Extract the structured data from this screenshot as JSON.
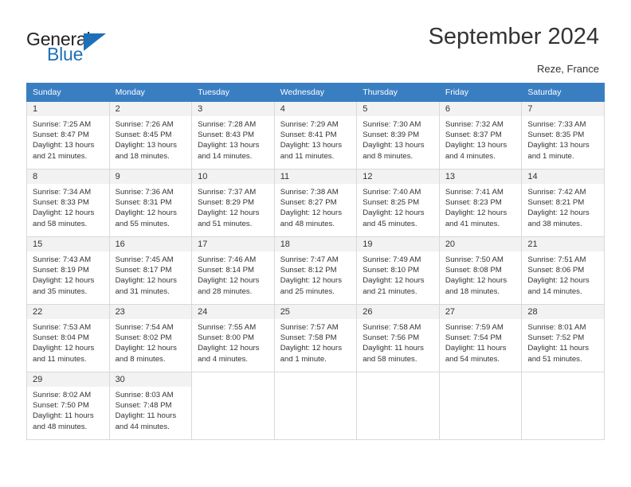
{
  "brand": {
    "name_top": "General",
    "name_bottom": "Blue",
    "accent_color": "#1d70b8"
  },
  "header": {
    "title": "September 2024",
    "location": "Reze, France"
  },
  "calendar": {
    "header_bg": "#3a7ec2",
    "weekdays": [
      "Sunday",
      "Monday",
      "Tuesday",
      "Wednesday",
      "Thursday",
      "Friday",
      "Saturday"
    ],
    "weeks": [
      [
        {
          "day": "1",
          "sunrise": "Sunrise: 7:25 AM",
          "sunset": "Sunset: 8:47 PM",
          "daylight1": "Daylight: 13 hours",
          "daylight2": "and 21 minutes."
        },
        {
          "day": "2",
          "sunrise": "Sunrise: 7:26 AM",
          "sunset": "Sunset: 8:45 PM",
          "daylight1": "Daylight: 13 hours",
          "daylight2": "and 18 minutes."
        },
        {
          "day": "3",
          "sunrise": "Sunrise: 7:28 AM",
          "sunset": "Sunset: 8:43 PM",
          "daylight1": "Daylight: 13 hours",
          "daylight2": "and 14 minutes."
        },
        {
          "day": "4",
          "sunrise": "Sunrise: 7:29 AM",
          "sunset": "Sunset: 8:41 PM",
          "daylight1": "Daylight: 13 hours",
          "daylight2": "and 11 minutes."
        },
        {
          "day": "5",
          "sunrise": "Sunrise: 7:30 AM",
          "sunset": "Sunset: 8:39 PM",
          "daylight1": "Daylight: 13 hours",
          "daylight2": "and 8 minutes."
        },
        {
          "day": "6",
          "sunrise": "Sunrise: 7:32 AM",
          "sunset": "Sunset: 8:37 PM",
          "daylight1": "Daylight: 13 hours",
          "daylight2": "and 4 minutes."
        },
        {
          "day": "7",
          "sunrise": "Sunrise: 7:33 AM",
          "sunset": "Sunset: 8:35 PM",
          "daylight1": "Daylight: 13 hours",
          "daylight2": "and 1 minute."
        }
      ],
      [
        {
          "day": "8",
          "sunrise": "Sunrise: 7:34 AM",
          "sunset": "Sunset: 8:33 PM",
          "daylight1": "Daylight: 12 hours",
          "daylight2": "and 58 minutes."
        },
        {
          "day": "9",
          "sunrise": "Sunrise: 7:36 AM",
          "sunset": "Sunset: 8:31 PM",
          "daylight1": "Daylight: 12 hours",
          "daylight2": "and 55 minutes."
        },
        {
          "day": "10",
          "sunrise": "Sunrise: 7:37 AM",
          "sunset": "Sunset: 8:29 PM",
          "daylight1": "Daylight: 12 hours",
          "daylight2": "and 51 minutes."
        },
        {
          "day": "11",
          "sunrise": "Sunrise: 7:38 AM",
          "sunset": "Sunset: 8:27 PM",
          "daylight1": "Daylight: 12 hours",
          "daylight2": "and 48 minutes."
        },
        {
          "day": "12",
          "sunrise": "Sunrise: 7:40 AM",
          "sunset": "Sunset: 8:25 PM",
          "daylight1": "Daylight: 12 hours",
          "daylight2": "and 45 minutes."
        },
        {
          "day": "13",
          "sunrise": "Sunrise: 7:41 AM",
          "sunset": "Sunset: 8:23 PM",
          "daylight1": "Daylight: 12 hours",
          "daylight2": "and 41 minutes."
        },
        {
          "day": "14",
          "sunrise": "Sunrise: 7:42 AM",
          "sunset": "Sunset: 8:21 PM",
          "daylight1": "Daylight: 12 hours",
          "daylight2": "and 38 minutes."
        }
      ],
      [
        {
          "day": "15",
          "sunrise": "Sunrise: 7:43 AM",
          "sunset": "Sunset: 8:19 PM",
          "daylight1": "Daylight: 12 hours",
          "daylight2": "and 35 minutes."
        },
        {
          "day": "16",
          "sunrise": "Sunrise: 7:45 AM",
          "sunset": "Sunset: 8:17 PM",
          "daylight1": "Daylight: 12 hours",
          "daylight2": "and 31 minutes."
        },
        {
          "day": "17",
          "sunrise": "Sunrise: 7:46 AM",
          "sunset": "Sunset: 8:14 PM",
          "daylight1": "Daylight: 12 hours",
          "daylight2": "and 28 minutes."
        },
        {
          "day": "18",
          "sunrise": "Sunrise: 7:47 AM",
          "sunset": "Sunset: 8:12 PM",
          "daylight1": "Daylight: 12 hours",
          "daylight2": "and 25 minutes."
        },
        {
          "day": "19",
          "sunrise": "Sunrise: 7:49 AM",
          "sunset": "Sunset: 8:10 PM",
          "daylight1": "Daylight: 12 hours",
          "daylight2": "and 21 minutes."
        },
        {
          "day": "20",
          "sunrise": "Sunrise: 7:50 AM",
          "sunset": "Sunset: 8:08 PM",
          "daylight1": "Daylight: 12 hours",
          "daylight2": "and 18 minutes."
        },
        {
          "day": "21",
          "sunrise": "Sunrise: 7:51 AM",
          "sunset": "Sunset: 8:06 PM",
          "daylight1": "Daylight: 12 hours",
          "daylight2": "and 14 minutes."
        }
      ],
      [
        {
          "day": "22",
          "sunrise": "Sunrise: 7:53 AM",
          "sunset": "Sunset: 8:04 PM",
          "daylight1": "Daylight: 12 hours",
          "daylight2": "and 11 minutes."
        },
        {
          "day": "23",
          "sunrise": "Sunrise: 7:54 AM",
          "sunset": "Sunset: 8:02 PM",
          "daylight1": "Daylight: 12 hours",
          "daylight2": "and 8 minutes."
        },
        {
          "day": "24",
          "sunrise": "Sunrise: 7:55 AM",
          "sunset": "Sunset: 8:00 PM",
          "daylight1": "Daylight: 12 hours",
          "daylight2": "and 4 minutes."
        },
        {
          "day": "25",
          "sunrise": "Sunrise: 7:57 AM",
          "sunset": "Sunset: 7:58 PM",
          "daylight1": "Daylight: 12 hours",
          "daylight2": "and 1 minute."
        },
        {
          "day": "26",
          "sunrise": "Sunrise: 7:58 AM",
          "sunset": "Sunset: 7:56 PM",
          "daylight1": "Daylight: 11 hours",
          "daylight2": "and 58 minutes."
        },
        {
          "day": "27",
          "sunrise": "Sunrise: 7:59 AM",
          "sunset": "Sunset: 7:54 PM",
          "daylight1": "Daylight: 11 hours",
          "daylight2": "and 54 minutes."
        },
        {
          "day": "28",
          "sunrise": "Sunrise: 8:01 AM",
          "sunset": "Sunset: 7:52 PM",
          "daylight1": "Daylight: 11 hours",
          "daylight2": "and 51 minutes."
        }
      ],
      [
        {
          "day": "29",
          "sunrise": "Sunrise: 8:02 AM",
          "sunset": "Sunset: 7:50 PM",
          "daylight1": "Daylight: 11 hours",
          "daylight2": "and 48 minutes."
        },
        {
          "day": "30",
          "sunrise": "Sunrise: 8:03 AM",
          "sunset": "Sunset: 7:48 PM",
          "daylight1": "Daylight: 11 hours",
          "daylight2": "and 44 minutes."
        },
        {
          "day": "",
          "sunrise": "",
          "sunset": "",
          "daylight1": "",
          "daylight2": ""
        },
        {
          "day": "",
          "sunrise": "",
          "sunset": "",
          "daylight1": "",
          "daylight2": ""
        },
        {
          "day": "",
          "sunrise": "",
          "sunset": "",
          "daylight1": "",
          "daylight2": ""
        },
        {
          "day": "",
          "sunrise": "",
          "sunset": "",
          "daylight1": "",
          "daylight2": ""
        },
        {
          "day": "",
          "sunrise": "",
          "sunset": "",
          "daylight1": "",
          "daylight2": ""
        }
      ]
    ]
  }
}
